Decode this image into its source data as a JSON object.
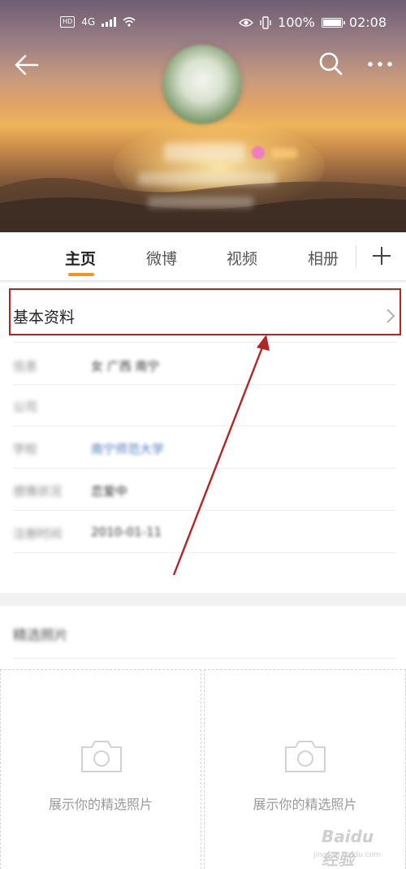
{
  "status_bar": {
    "network": "4G",
    "battery": "100%",
    "battery_level": 1.0,
    "time": "02:08",
    "icons": [
      "hd-icon",
      "signal-icon",
      "wifi-icon",
      "eye-icon",
      "vibrate-icon",
      "battery-icon"
    ]
  },
  "header": {
    "back_icon": "back-arrow-icon",
    "search_icon": "search-icon",
    "more_icon": "more-dots-icon",
    "profile_name": "",
    "profile_bio": "",
    "profile_meta": ""
  },
  "tabs": [
    {
      "label": "主页",
      "active": true
    },
    {
      "label": "微博",
      "active": false
    },
    {
      "label": "视频",
      "active": false
    },
    {
      "label": "相册",
      "active": false
    }
  ],
  "tab_add_icon": "plus-icon",
  "basic_info": {
    "title": "基本资料",
    "chevron_icon": "chevron-right-icon",
    "rows": [
      {
        "label": "信息",
        "value": "女 广西 南宁",
        "link": false
      },
      {
        "label": "公司",
        "value": "",
        "link": true
      },
      {
        "label": "学校",
        "value": "南宁师范大学",
        "link": true
      },
      {
        "label": "感情状况",
        "value": "恋爱中",
        "link": false
      },
      {
        "label": "注册时间",
        "value": "2010-01-11",
        "link": false
      }
    ],
    "update_link": ""
  },
  "photos": {
    "title": "精选照片",
    "slots": [
      {
        "caption": "展示你的精选照片",
        "icon": "camera-icon"
      },
      {
        "caption": "展示你的精选照片",
        "icon": "camera-icon"
      }
    ]
  },
  "watermark": {
    "text": "Baidu 经验",
    "sub": "jingyan.baidu.com"
  },
  "colors": {
    "accent": "#f7931e",
    "highlight_box": "#b42424",
    "link": "#4a78b8",
    "arrow": "#b42424"
  }
}
